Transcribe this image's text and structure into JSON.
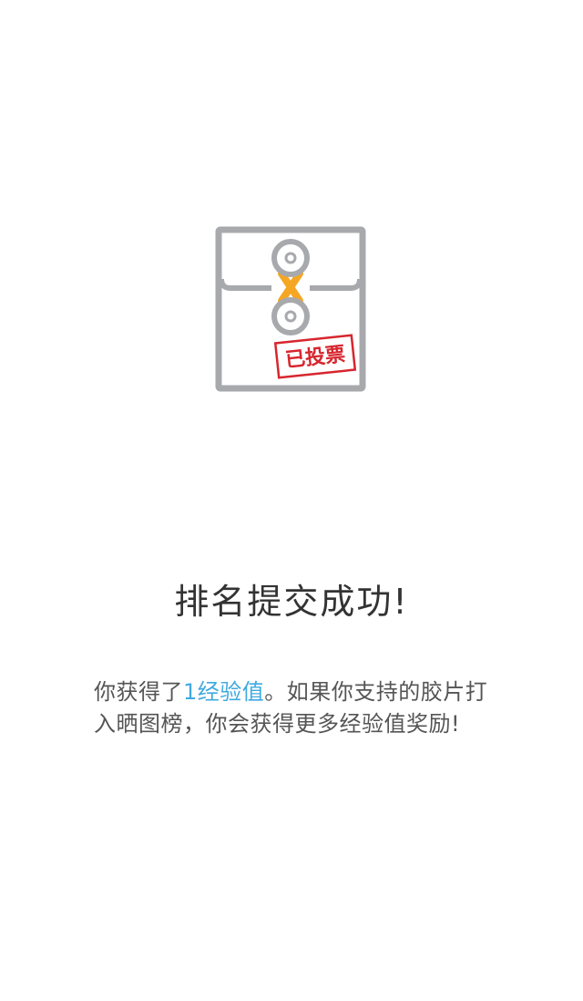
{
  "stamp": {
    "text": "已投票"
  },
  "result": {
    "title": "排名提交成功!",
    "message_prefix": "你获得了",
    "reward": "1经验值",
    "message_suffix": "。如果你支持的胶片打入晒图榜，你会获得更多经验值奖励!"
  },
  "colors": {
    "envelope": "#a7a9ac",
    "string": "#f5a623",
    "stamp": "#d7262e",
    "highlight": "#3fa9e0",
    "title": "#333333",
    "text": "#555555"
  },
  "icons": {
    "envelope": "voted-envelope-icon"
  }
}
